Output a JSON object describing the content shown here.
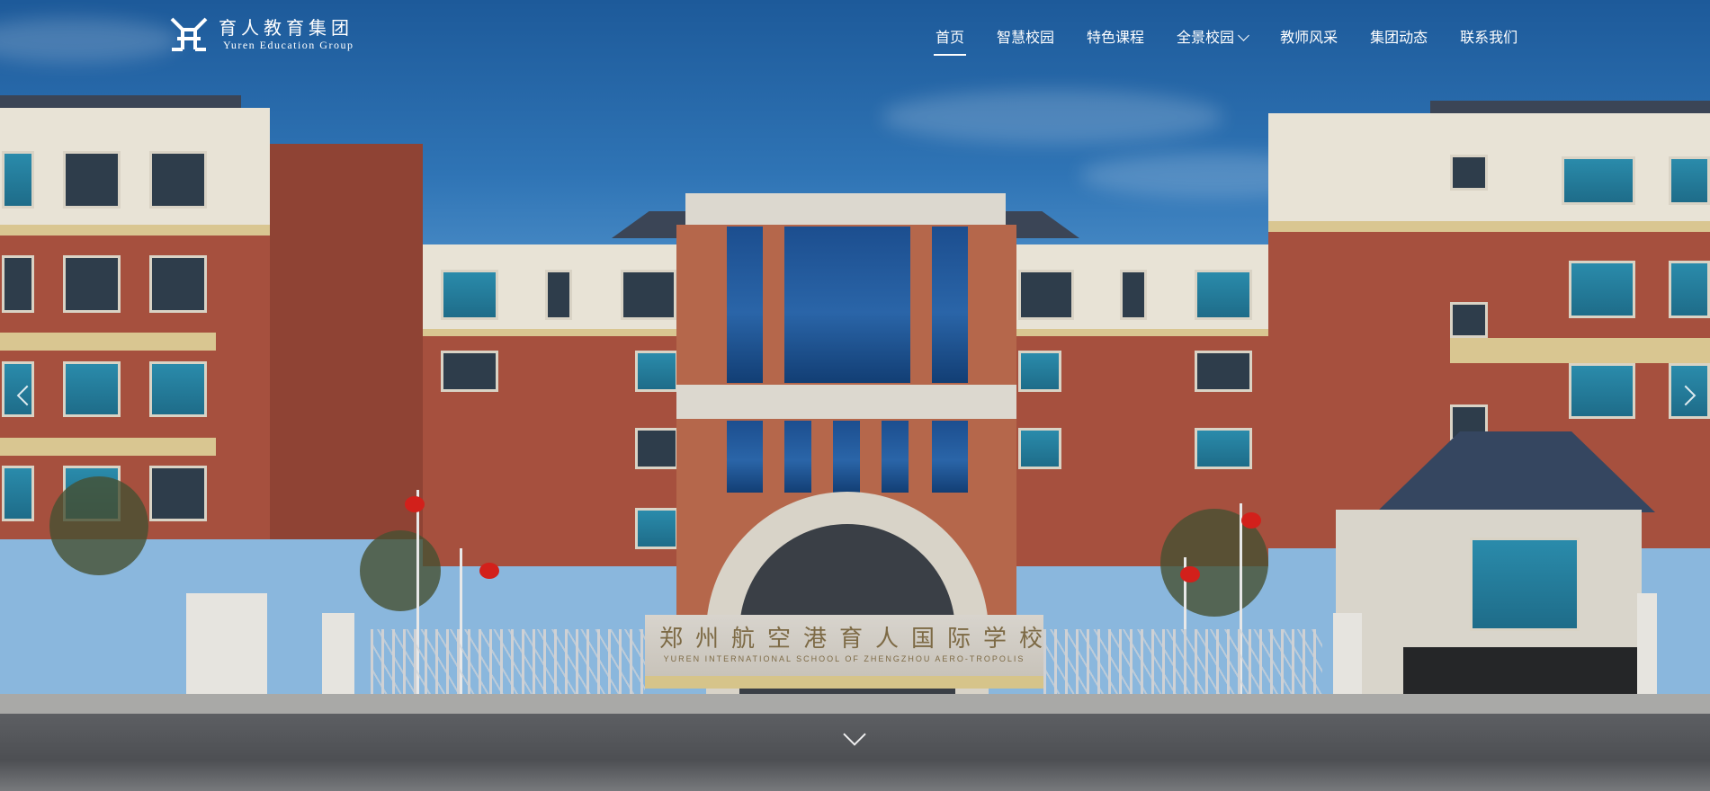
{
  "brand": {
    "name_cn": "育人教育集团",
    "name_en": "Yuren Education Group",
    "logo_icon": "yr-monogram-icon"
  },
  "nav": {
    "items": [
      {
        "label": "首页",
        "active": true
      },
      {
        "label": "智慧校园",
        "active": false
      },
      {
        "label": "特色课程",
        "active": false
      },
      {
        "label": "全景校园",
        "active": false,
        "has_dropdown": true
      },
      {
        "label": "教师风采",
        "active": false
      },
      {
        "label": "集团动态",
        "active": false
      },
      {
        "label": "联系我们",
        "active": false
      }
    ]
  },
  "hero": {
    "sign_cn": "郑州航空港育人国际学校",
    "sign_en": "YUREN INTERNATIONAL SCHOOL OF ZHENGZHOU AERO-TROPOLIS",
    "prev_icon": "chevron-left-icon",
    "next_icon": "chevron-right-icon",
    "scroll_icon": "chevron-down-icon"
  },
  "colors": {
    "sky": "#2f74b5",
    "brick": "#a6503e",
    "nav_text": "#ffffff"
  }
}
